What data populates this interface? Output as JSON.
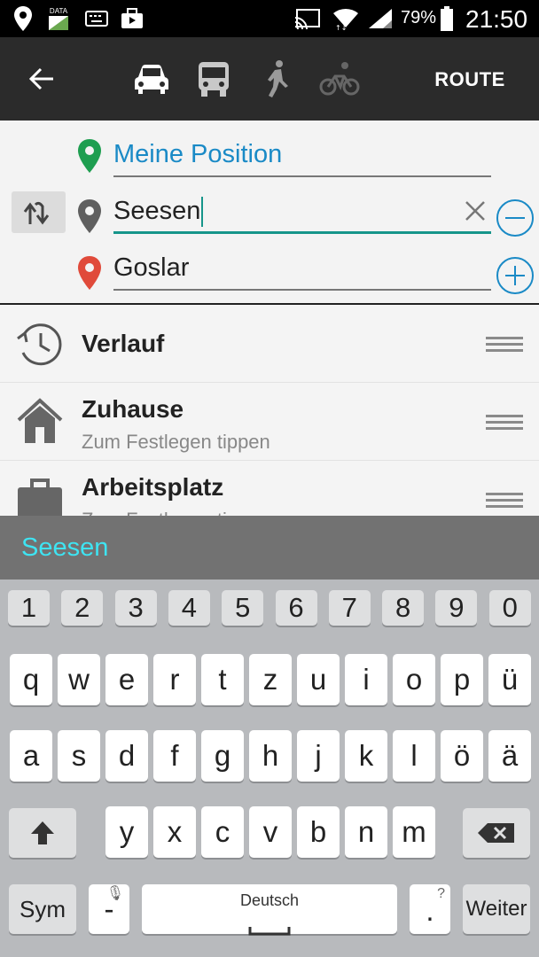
{
  "status_bar": {
    "icons": [
      "location-icon",
      "data-sim-icon",
      "keyboard-icon",
      "briefcase-notification-icon",
      "cast-icon",
      "wifi-icon",
      "signal-icon",
      "battery-icon"
    ],
    "data_label": "DATA",
    "battery": "79%",
    "time": "21:50"
  },
  "app_bar": {
    "modes": [
      "car",
      "bus",
      "walk",
      "bicycle"
    ],
    "route_label": "ROUTE"
  },
  "route": {
    "origin": "Meine Position",
    "waypoint": "Seesen",
    "destination": "Goslar"
  },
  "list": {
    "items": [
      {
        "title": "Verlauf",
        "subtitle": ""
      },
      {
        "title": "Zuhause",
        "subtitle": "Zum Festlegen tippen"
      },
      {
        "title": "Arbeitsplatz",
        "subtitle": "Zum Festlegen tippen"
      }
    ]
  },
  "suggestion": {
    "word": "Seesen"
  },
  "keyboard": {
    "numbers": [
      "1",
      "2",
      "3",
      "4",
      "5",
      "6",
      "7",
      "8",
      "9",
      "0"
    ],
    "row1": [
      "q",
      "w",
      "e",
      "r",
      "t",
      "z",
      "u",
      "i",
      "o",
      "p",
      "ü"
    ],
    "row2": [
      "a",
      "s",
      "d",
      "f",
      "g",
      "h",
      "j",
      "k",
      "l",
      "ö",
      "ä"
    ],
    "row3": [
      "y",
      "x",
      "c",
      "v",
      "b",
      "n",
      "m"
    ],
    "sym_label": "Sym",
    "dash_key": "-",
    "space_label": "Deutsch",
    "dot_key": ".",
    "dot_hint": "?",
    "enter_label": "Weiter"
  },
  "colors": {
    "app_bar": "#2b2b2b",
    "accent_blue": "#1a8ac6",
    "accent_teal": "#16958a",
    "origin_pin": "#1e9e50",
    "destination_pin": "#e04a3a",
    "suggestion_text": "#3ee4f2"
  }
}
